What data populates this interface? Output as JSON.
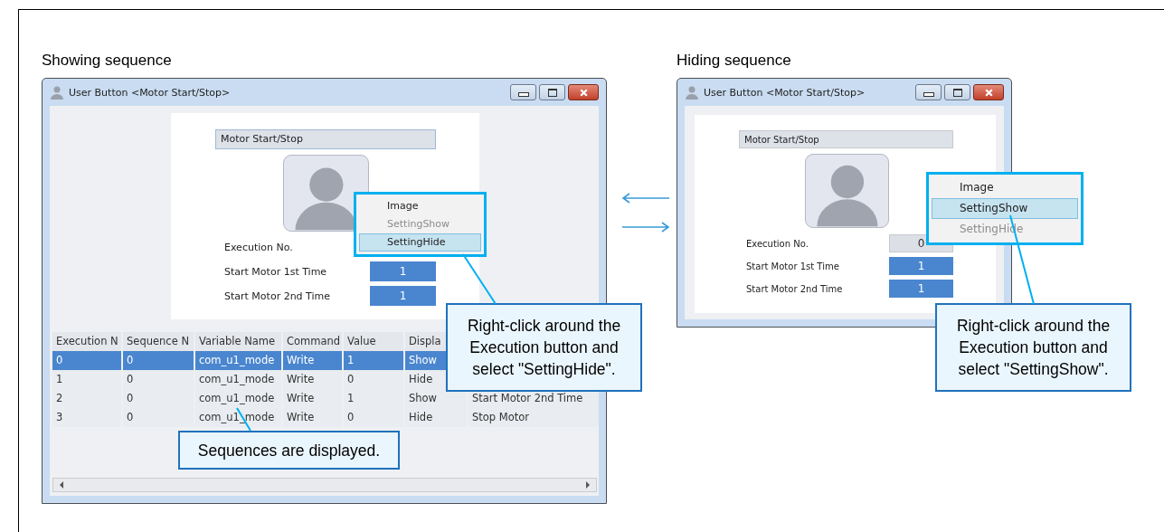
{
  "panels": [
    {
      "caption": "Showing sequence",
      "window": {
        "title": "User Button <Motor Start/Stop>",
        "name_field": "Motor Start/Stop",
        "fields": [
          {
            "label": "Execution No.",
            "kind": "plain"
          },
          {
            "label": "Start Motor 1st Time",
            "value": "1",
            "kind": "button"
          },
          {
            "label": "Start Motor 2nd Time",
            "value": "1",
            "kind": "button"
          }
        ],
        "table": {
          "columns": [
            "Execution N",
            "Sequence N",
            "Variable Name",
            "Command",
            "Value",
            "Displa"
          ],
          "rows": [
            {
              "selected": true,
              "cells": [
                "0",
                "0",
                "com_u1_mode",
                "Write",
                "1",
                "Show"
              ]
            },
            {
              "selected": false,
              "cells": [
                "1",
                "0",
                "com_u1_mode",
                "Write",
                "0",
                "Hide"
              ]
            },
            {
              "selected": false,
              "cells": [
                "2",
                "0",
                "com_u1_mode",
                "Write",
                "1",
                "Show",
                "Start Motor 2nd Time"
              ]
            },
            {
              "selected": false,
              "cells": [
                "3",
                "0",
                "com_u1_mode",
                "Write",
                "0",
                "Hide",
                "Stop Motor"
              ]
            }
          ]
        }
      },
      "menu": [
        {
          "label": "Image",
          "selected": false,
          "disabled": false
        },
        {
          "label": "SettingShow",
          "selected": false,
          "disabled": true
        },
        {
          "label": "SettingHide",
          "selected": true,
          "disabled": false
        }
      ],
      "callouts": [
        "Right-click around the Execution button and select \"SettingHide\".",
        "Sequences are displayed."
      ]
    },
    {
      "caption": "Hiding sequence",
      "window": {
        "title": "User Button <Motor Start/Stop>",
        "name_field": "Motor Start/Stop",
        "fields": [
          {
            "label": "Execution No.",
            "value": "0",
            "kind": "plain"
          },
          {
            "label": "Start Motor 1st Time",
            "value": "1",
            "kind": "button"
          },
          {
            "label": "Start Motor 2nd Time",
            "value": "1",
            "kind": "button"
          }
        ]
      },
      "menu": [
        {
          "label": "Image",
          "selected": false,
          "disabled": false
        },
        {
          "label": "SettingShow",
          "selected": true,
          "disabled": false
        },
        {
          "label": "SettingHide",
          "selected": false,
          "disabled": true
        }
      ],
      "callouts": [
        "Right-click around the Execution button and select \"SettingShow\"."
      ]
    }
  ]
}
